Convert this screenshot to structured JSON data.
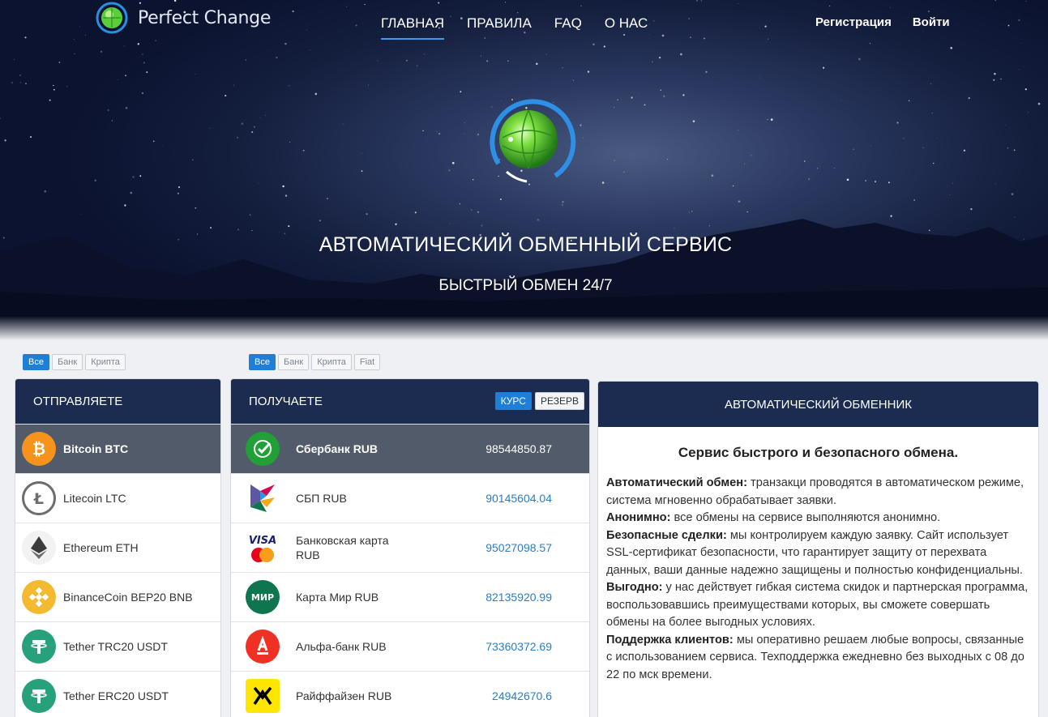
{
  "brand": {
    "name": "Perfect Change"
  },
  "nav": [
    {
      "label": "ГЛАВНАЯ",
      "active": true
    },
    {
      "label": "ПРАВИЛА",
      "active": false
    },
    {
      "label": "FAQ",
      "active": false
    },
    {
      "label": "О НАС",
      "active": false
    }
  ],
  "auth": {
    "register": "Регистрация",
    "login": "Войти"
  },
  "hero": {
    "title": "АВТОМАТИЧЕСКИЙ ОБМЕННЫЙ СЕРВИС",
    "subtitle": "БЫСТРЫЙ ОБМЕН 24/7"
  },
  "give_filters": [
    "Все",
    "Банк",
    "Крипта"
  ],
  "get_filters": [
    "Все",
    "Банк",
    "Крипта",
    "Fiat"
  ],
  "give": {
    "title": "ОТПРАВЛЯЕТЕ",
    "items": [
      {
        "name": "Bitcoin BTC",
        "icon": "bitcoin-icon",
        "color": "#f7931a",
        "selected": true
      },
      {
        "name": "Litecoin LTC",
        "icon": "litecoin-icon",
        "color": "#bebebe"
      },
      {
        "name": "Ethereum ETH",
        "icon": "ethereum-icon",
        "color": "#3c3c3d"
      },
      {
        "name": "BinanceCoin BEP20 BNB",
        "icon": "binance-icon",
        "color": "#f3ba2f"
      },
      {
        "name": "Tether TRC20 USDT",
        "icon": "tether-icon",
        "color": "#26a17b"
      },
      {
        "name": "Tether ERC20 USDT",
        "icon": "tether-icon",
        "color": "#26a17b"
      }
    ]
  },
  "get": {
    "title": "ПОЛУЧАЕТЕ",
    "toggle": {
      "rate": "КУРС",
      "reserve": "РЕЗЕРВ"
    },
    "items": [
      {
        "name": "Сбербанк RUB",
        "amount": "98544850.87",
        "icon": "sberbank-icon",
        "color": "#21a038",
        "selected": true
      },
      {
        "name": "СБП RUB",
        "amount": "90145604.04",
        "icon": "sbp-icon",
        "color": "#5b57a2"
      },
      {
        "name": "Банковская карта RUB",
        "amount": "95027098.57",
        "icon": "visa-mastercard-icon",
        "color": "#1a1f71"
      },
      {
        "name": "Карта Мир RUB",
        "amount": "82135920.99",
        "icon": "mir-icon",
        "color": "#0f754e"
      },
      {
        "name": "Альфа-банк RUB",
        "amount": "73360372.69",
        "icon": "alfabank-icon",
        "color": "#ef3124"
      },
      {
        "name": "Райффайзен RUB",
        "amount": "24942670.6",
        "icon": "raiffeisen-icon",
        "color": "#fee600"
      }
    ]
  },
  "info": {
    "header": "АВТОМАТИЧЕСКИЙ ОБМЕННИК",
    "title": "Сервис быстрого и безопасного обмена.",
    "paragraphs": [
      {
        "label": "Автоматический обмен:",
        "text": " транзакци проводятся в автоматическом режиме, система мгновенно обрабатывает заявки."
      },
      {
        "label": "Анонимно:",
        "text": " все обмены на сервисе выполняются анонимно."
      },
      {
        "label": "Безопасные сделки:",
        "text": " мы контролируем каждую заявку. Сайт использует SSL-сертификат безопасности, что гарантирует защиту от перехвата данных, ваши данные надежно защищены и полностью конфиденциальны."
      },
      {
        "label": "Выгодно:",
        "text": " у нас действует гибкая система скидок и партнерская программа, воспользовавшись преимуществами которых, вы сможете совершать обмены на более выгодных условиях."
      },
      {
        "label": "Поддержка клиентов:",
        "text": " мы оперативно решаем любые вопросы, связанные с использованием сервиса. Техподдержка ежедневно без выходных с 08 до 22 по мск времени."
      }
    ]
  }
}
